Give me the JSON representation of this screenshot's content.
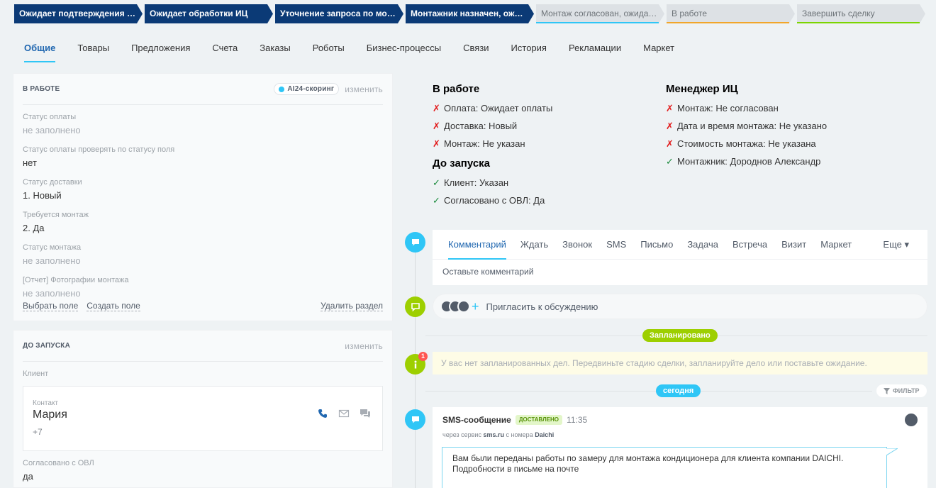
{
  "stages": [
    {
      "label": "Ожидает подтверждения ОКК",
      "state": "done",
      "width": 181
    },
    {
      "label": "Ожидает обработки ИЦ",
      "state": "done",
      "width": 181
    },
    {
      "label": "Уточнение запроса по монта…",
      "state": "done",
      "width": 181
    },
    {
      "label": "Монтажник назначен, ожида…",
      "state": "done",
      "width": 181
    },
    {
      "label": "Монтаж согласован, ожидает …",
      "state": "todo",
      "color": "#2fc6f6",
      "width": 181
    },
    {
      "label": "В работе",
      "state": "todo",
      "color": "#f2a62a",
      "width": 181
    },
    {
      "label": "Завершить сделку",
      "state": "todo",
      "color": "#7bd500",
      "width": 181
    }
  ],
  "tabs": [
    "Общие",
    "Товары",
    "Предложения",
    "Счета",
    "Заказы",
    "Роботы",
    "Бизнес-процессы",
    "Связи",
    "История",
    "Рекламации",
    "Маркет"
  ],
  "section_work": {
    "title": "В РАБОТЕ",
    "ai_label": "AI24-скоринг",
    "change_label": "изменить",
    "fields": [
      {
        "label": "Статус оплаты",
        "value": "не заполнено",
        "empty": true
      },
      {
        "label": "Статус оплаты проверять по статусу поля",
        "value": "нет",
        "empty": false
      },
      {
        "label": "Статус доставки",
        "value": "1. Новый",
        "empty": false
      },
      {
        "label": "Требуется монтаж",
        "value": "2. Да",
        "empty": false
      },
      {
        "label": "Статус монтажа",
        "value": "не заполнено",
        "empty": true
      },
      {
        "label": "[Отчет] Фотографии монтажа",
        "value": "не заполнено",
        "empty": true
      }
    ],
    "select_field": "Выбрать поле",
    "create_field": "Создать поле",
    "delete_section": "Удалить раздел"
  },
  "section_launch": {
    "title": "ДО ЗАПУСКА",
    "change_label": "изменить",
    "client_label": "Клиент",
    "contact_label": "Контакт",
    "contact_name": "Мария",
    "contact_phone": "+7",
    "agreed_label": "Согласовано с ОВЛ",
    "agreed_value": "да"
  },
  "summary": {
    "col1_title": "В работе",
    "col1_items": [
      {
        "mark": "x",
        "text": "Оплата: Ожидает оплаты"
      },
      {
        "mark": "x",
        "text": "Доставка: Новый"
      },
      {
        "mark": "x",
        "text": "Монтаж: Не указан"
      }
    ],
    "col1b_title": "До запуска",
    "col1b_items": [
      {
        "mark": "ok",
        "text": "Клиент: Указан"
      },
      {
        "mark": "ok",
        "text": "Согласовано с ОВЛ: Да"
      }
    ],
    "col2_title": "Менеджер ИЦ",
    "col2_items": [
      {
        "mark": "x",
        "text": "Монтаж: Не согласован"
      },
      {
        "mark": "x",
        "text": "Дата и время монтажа: Не указано"
      },
      {
        "mark": "x",
        "text": "Стоимость монтажа: Не указана"
      },
      {
        "mark": "ok",
        "text": "Монтажник: Дороднов Александр"
      }
    ]
  },
  "composer": {
    "tabs": [
      "Комментарий",
      "Ждать",
      "Звонок",
      "SMS",
      "Письмо",
      "Задача",
      "Встреча",
      "Визит",
      "Маркет"
    ],
    "more": "Еще ▾",
    "placeholder": "Оставьте комментарий"
  },
  "invite_text": "Пригласить к обсуждению",
  "planned_pill": "Запланировано",
  "planned_text": "У вас нет запланированных дел. Передвиньте стадию сделки, запланируйте дело или поставьте ожидание.",
  "planned_badge": "1",
  "today_pill": "сегодня",
  "filter_label": "ФИЛЬТР",
  "sms": {
    "title": "SMS-сообщение",
    "status": "доставлено",
    "time": "11:35",
    "via_prefix": "через сервис",
    "service": "sms.ru",
    "from_prefix": "с номера",
    "sender": "Daichi",
    "line1": "Вам были переданы работы по замеру для монтажа кондиционера для клиента компании DAICHI.",
    "line2": "Подробности в письме на почте"
  }
}
